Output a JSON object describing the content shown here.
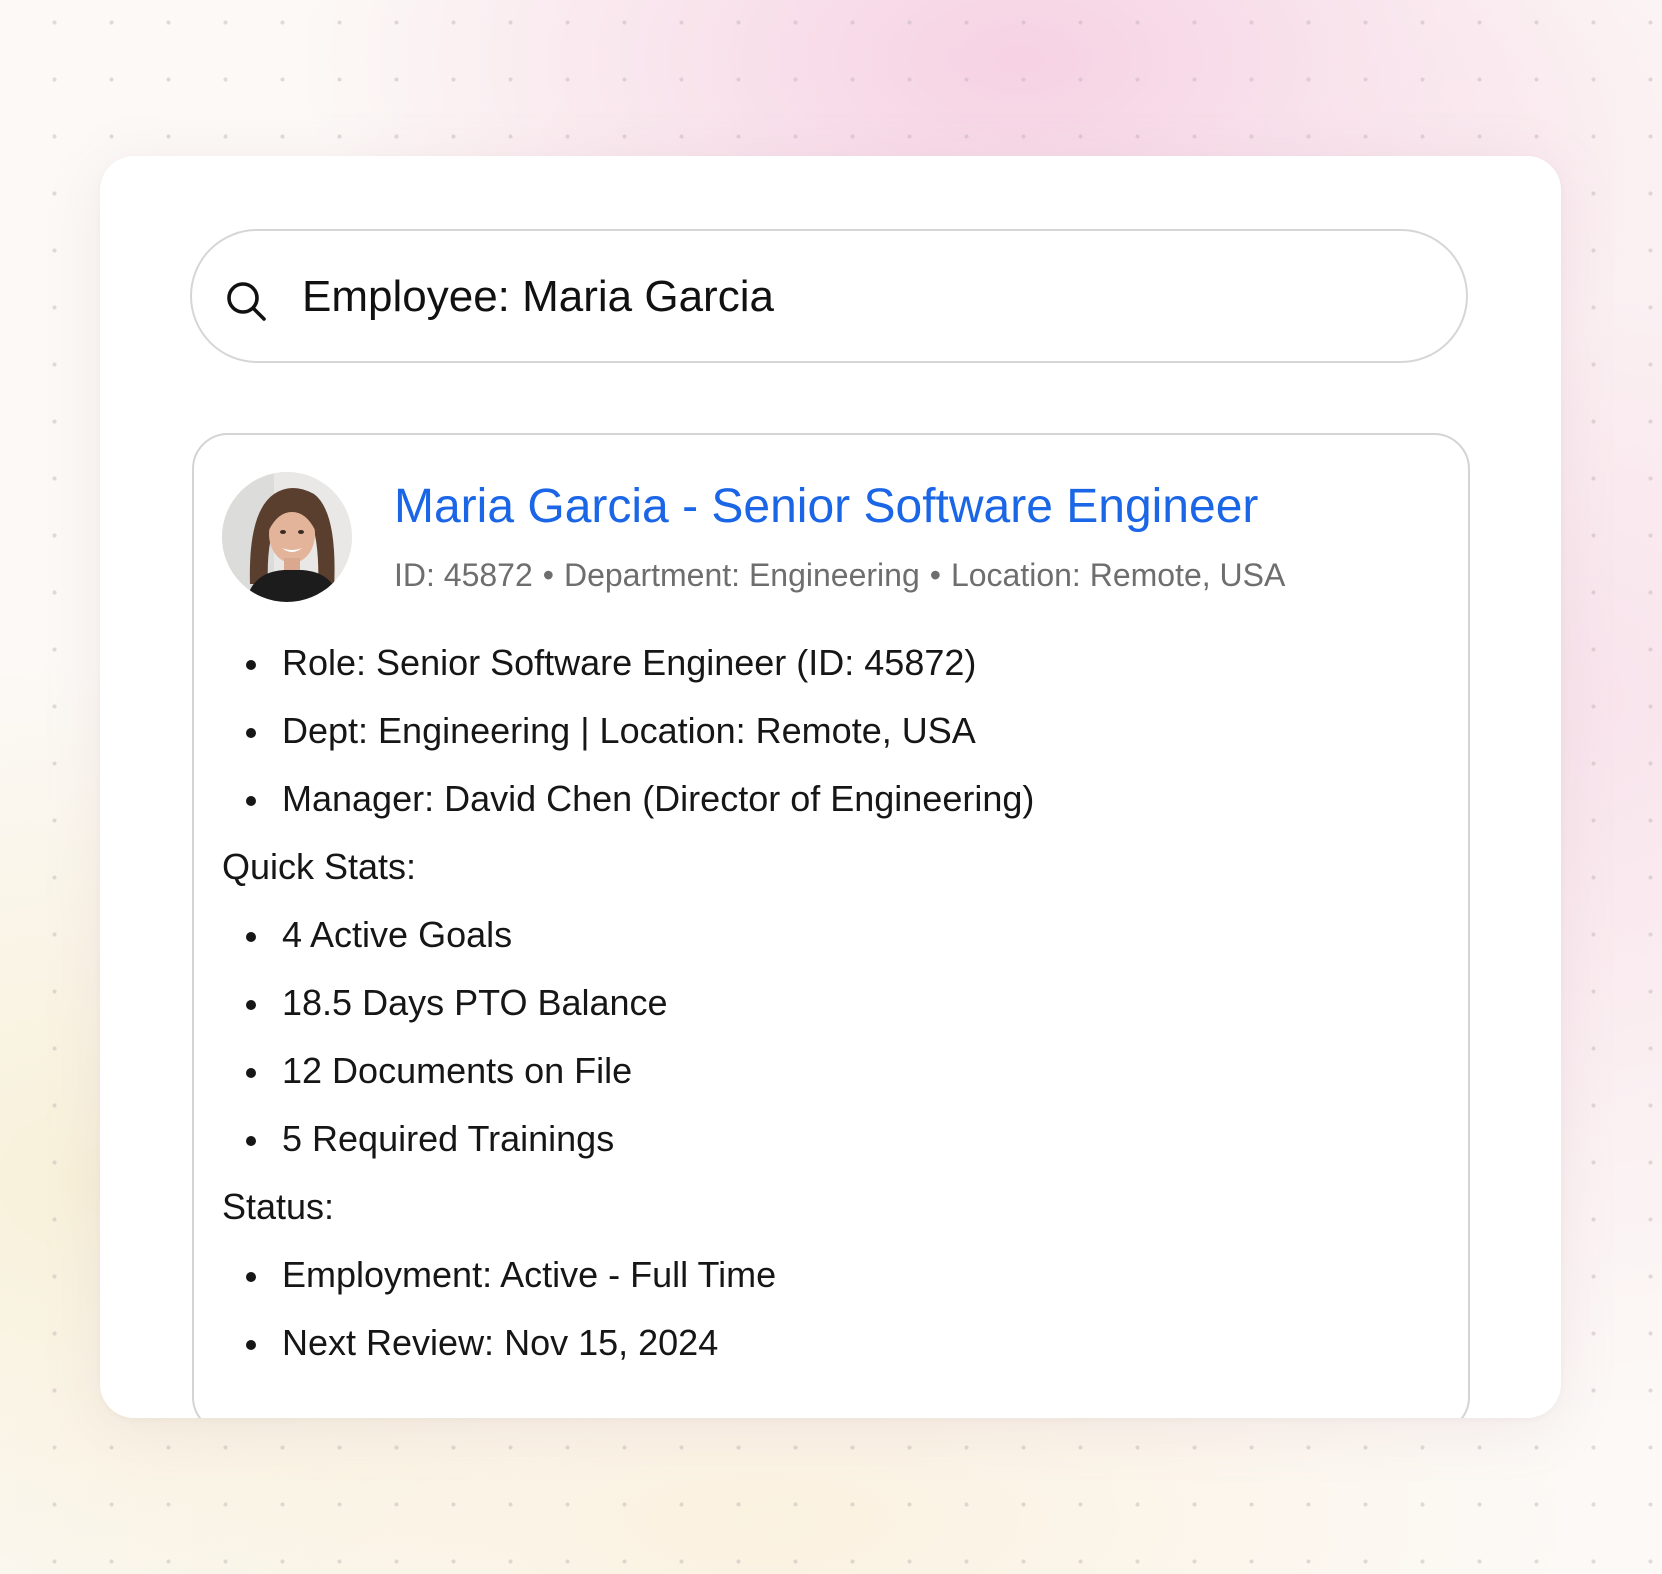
{
  "search": {
    "icon": "search-icon",
    "query": "Employee: Maria Garcia"
  },
  "result": {
    "avatar_icon": "employee-photo",
    "title": "Maria Garcia - Senior Software Engineer",
    "meta": {
      "id": "ID: 45872",
      "department": "Department: Engineering",
      "location": "Location: Remote, USA",
      "separator": "•"
    },
    "details": [
      "Role: Senior Software Engineer (ID: 45872)",
      "Dept: Engineering | Location: Remote, USA",
      "Manager: David Chen (Director of Engineering)"
    ],
    "quick_stats": {
      "heading": "Quick Stats:",
      "items": [
        "4 Active Goals",
        "18.5 Days PTO Balance",
        "12 Documents on File",
        "5 Required Trainings"
      ]
    },
    "status": {
      "heading": "Status:",
      "items": [
        "Employment: Active - Full Time",
        "Next Review: Nov 15, 2024"
      ]
    }
  },
  "colors": {
    "title": "#1a66e6",
    "meta": "#6e6e6e",
    "text": "#161616",
    "border": "#d6d6d6"
  }
}
